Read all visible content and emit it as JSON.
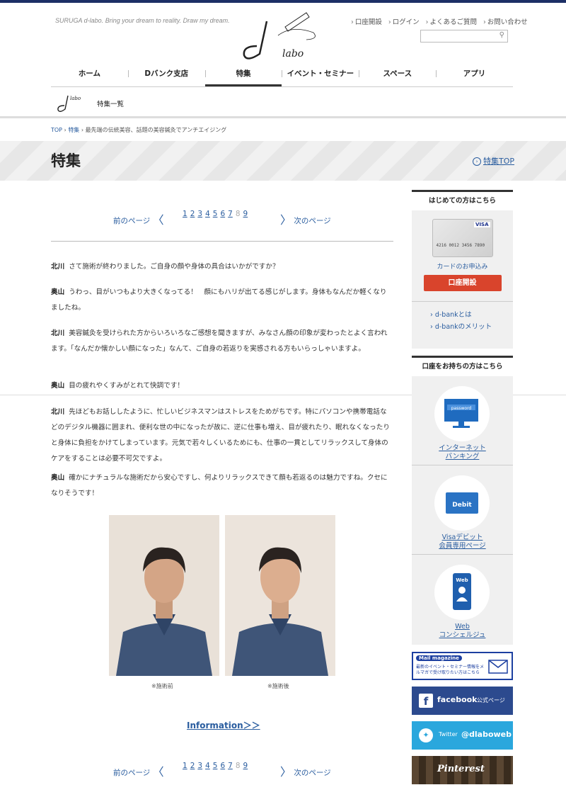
{
  "header": {
    "tagline": "SURUGA d-labo. Bring your dream to reality. Draw my dream.",
    "logo_text": "labo",
    "utility": [
      "口座開設",
      "ログイン",
      "よくあるご質問",
      "お問い合わせ"
    ],
    "search_placeholder": ""
  },
  "nav": {
    "items": [
      "ホーム",
      "Dバンク支店",
      "特集",
      "イベント・セミナー",
      "スペース",
      "アプリ"
    ],
    "active": "特集"
  },
  "subnav": {
    "link": "特集一覧"
  },
  "breadcrumb": {
    "top": "TOP",
    "section": "特集",
    "current": "最先端の伝統美容、話題の美容鍼灸でアンチエイジング"
  },
  "page": {
    "title": "特集",
    "top_link": "特集TOP"
  },
  "pager": {
    "prev": "前のページ",
    "next": "次のページ",
    "pages": [
      "1",
      "2",
      "3",
      "4",
      "5",
      "6",
      "7",
      "8",
      "9"
    ],
    "current": "8"
  },
  "dialogue": [
    {
      "speaker": "北川",
      "text": "さて施術が終わりました。ご自身の顔や身体の具合はいかがですか？"
    },
    {
      "speaker": "奥山",
      "text": "うわっ、目がいつもより大きくなってる！　顔にもハリが出てる感じがします。身体もなんだか軽くなりましたね。"
    },
    {
      "speaker": "北川",
      "text": "美容鍼灸を受けられた方からいろいろなご感想を聞きますが、みなさん顔の印象が変わったとよく言われます。「なんだか懐かしい顔になった」なんて、ご自身の若返りを実感される方もいらっしゃいますよ。"
    },
    {
      "speaker": "奥山",
      "text": "目の疲れやくすみがとれて快調です！"
    },
    {
      "speaker": "北川",
      "text": "先ほどもお話ししたように、忙しいビジネスマンはストレスをためがちです。特にパソコンや携帯電話などのデジタル機器に囲まれ、便利な世の中になったが故に、逆に仕事も増え、目が疲れたり、眠れなくなったりと身体に負担をかけてしまっています。元気で若々しくいるためにも、仕事の一貫としてリラックスして身体のケアをすることは必要不可欠ですよ。"
    },
    {
      "speaker": "奥山",
      "text": "確かにナチュラルな施術だから安心ですし、何よりリラックスできて顔も若返るのは魅力ですね。クセになりそうです！"
    }
  ],
  "photos": {
    "before": "※施術前",
    "after": "※施術後"
  },
  "info_link": "Information＞＞",
  "sidebar": {
    "new_head": "はじめての方はこちら",
    "card_visa": "VISA",
    "card_number": "4216 0012 3456 7890",
    "card_link": "カードのお申込み",
    "open_button": "口座開設",
    "links": [
      "d-bankとは",
      "d-bankのメリット"
    ],
    "owner_head": "口座をお持ちの方はこちら",
    "services": [
      {
        "line1": "インターネット",
        "line2": "バンキング",
        "icon_text": "password"
      },
      {
        "line1": "Visaデビット",
        "line2": "会員専用ページ",
        "icon_text": "Debit"
      },
      {
        "line1": "Web",
        "line2": "コンシェルジュ",
        "icon_text": "Web"
      }
    ],
    "mail_title": "Mail magazine",
    "mail_text": "最新のイベント・セミナー情報をメルマガで受け取りたい方はこちら",
    "fb_text": "facebook",
    "fb_sub": "公式ページ",
    "tw_text": "Twitter",
    "tw_handle": "@dlaboweb",
    "pin_text": "Pinterest"
  }
}
